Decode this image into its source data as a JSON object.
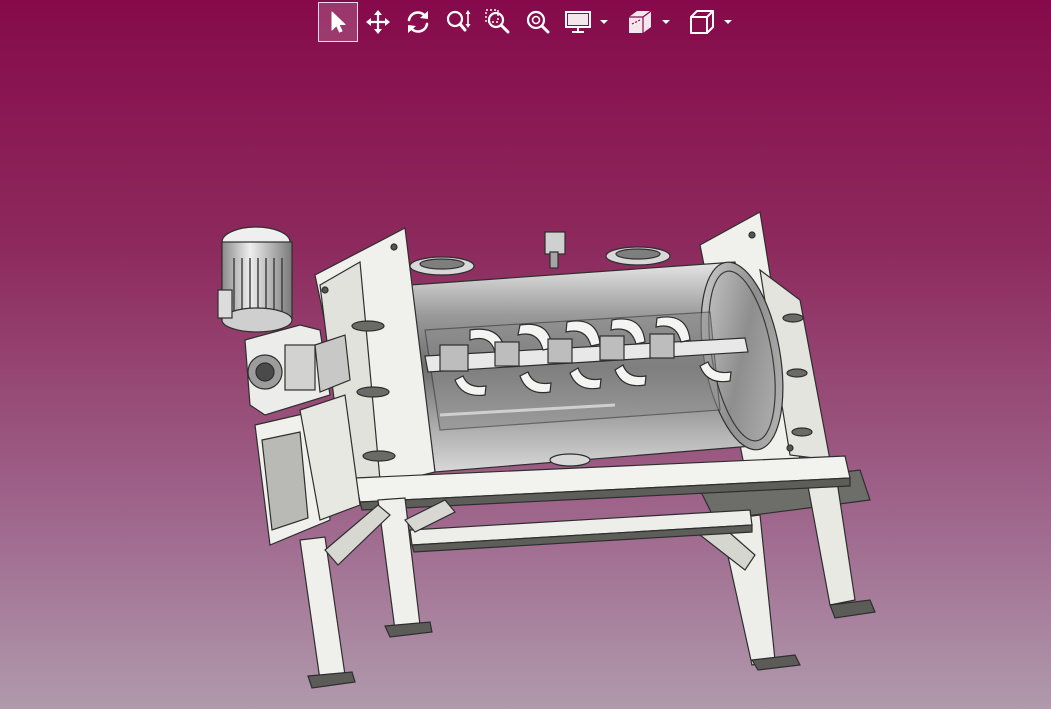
{
  "toolbar": {
    "buttons": [
      {
        "icon": "pointer-icon",
        "active": true
      },
      {
        "icon": "pan-icon"
      },
      {
        "icon": "rotate-icon"
      },
      {
        "icon": "zoom-icon"
      },
      {
        "icon": "zoom-window-icon"
      },
      {
        "icon": "zoom-fit-icon"
      },
      {
        "icon": "display-mode-icon",
        "dropdown": true
      },
      {
        "icon": "section-view-icon",
        "dropdown": true
      },
      {
        "icon": "view-cube-icon",
        "dropdown": true
      }
    ]
  },
  "viewport": {
    "model": "ribbon-blender-cad-model",
    "background_top": "#860a4b",
    "background_bottom": "#b09aac"
  }
}
